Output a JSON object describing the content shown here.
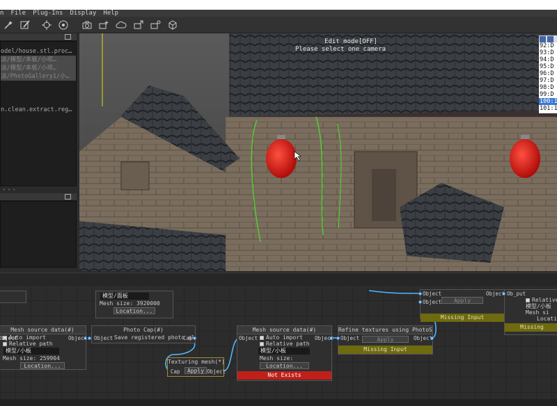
{
  "menu": [
    "n",
    "File",
    "Plug-Ins",
    "Display",
    "Help"
  ],
  "toolbar_icons": [
    "wand-icon",
    "edit-icon",
    "target-icon",
    "crosshair-icon",
    "camera-rotate-icon",
    "camera-add-icon",
    "cloud-icon",
    "camera-export-icon",
    "camera-share-icon",
    "cube-icon"
  ],
  "left_panel": {
    "tree_items": [
      "odel/house.stl.proc…",
      "淡/模型/本板/小坝…",
      "淡/模型/本板/小坝…",
      "淡/PhotoGallery1/小…",
      "",
      "",
      "",
      "n.clean.extract.reg…"
    ],
    "selected_indices": [
      1,
      2,
      3
    ]
  },
  "viewport": {
    "edit_mode": "Edit mode[OFF]",
    "hint": "Please select one camera"
  },
  "camera_list": {
    "items": [
      "92:D",
      "93:D",
      "94:D",
      "95:D",
      "96:D",
      "97:D",
      "98:D",
      "99:D",
      "100:1",
      "101:1"
    ],
    "selected_index": 8
  },
  "graph": {
    "node_top": {
      "field": "模型/面板",
      "mesh_size": "Mesh size: 3920000",
      "button": "Location..."
    },
    "node_left": {
      "title": "Mesh source data(#)",
      "auto_import": "Auto import",
      "relative_path": "Relative path",
      "field": "模型/小板",
      "mesh_size": "Mesh size: 259904",
      "button": "Location...",
      "port_out": "Object",
      "port_in": "Object"
    },
    "node_photo": {
      "title": "Photo Cap(#)",
      "text": "Save registered photo album",
      "port_in": "Object",
      "port_out": "Cap"
    },
    "node_texturing": {
      "title": "Texturing mesh(*)",
      "port_in": "Cap",
      "button": "Apply",
      "port_out": "Object"
    },
    "node_mesh2": {
      "title": "Mesh source data(#)",
      "auto_import": "Auto import",
      "relative_path": "Relative path",
      "field": "模型/小板",
      "mesh_size": "Mesh size:",
      "button": "Location...",
      "status": "Not Exists",
      "port_in": "Object",
      "port_out": "Object"
    },
    "node_refine": {
      "title": "Refine textures using PhotoShop(*)",
      "port_in": "Object",
      "button": "Apply",
      "port_out": "Object",
      "status": "Missing Input"
    },
    "node_missing": {
      "port1": "Object",
      "port2": "Object",
      "button": "Apply",
      "status": "Missing Input"
    },
    "node_right": {
      "port_in": "Object",
      "port_out": "Ob_put",
      "relative_path": "Relative pa",
      "field": "模型/小板",
      "mesh_size": "Mesh si",
      "button": "Locati",
      "status": "Missing"
    }
  }
}
